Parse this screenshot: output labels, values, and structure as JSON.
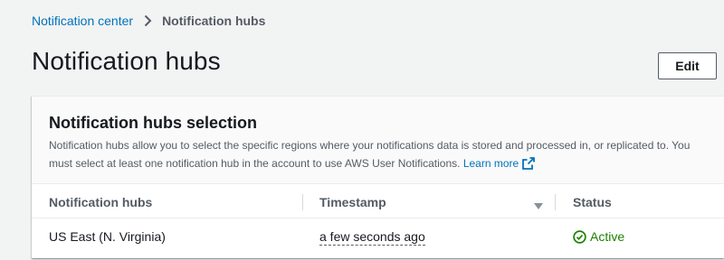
{
  "breadcrumb": {
    "parent": "Notification center",
    "current": "Notification hubs"
  },
  "page": {
    "title": "Notification hubs",
    "edit_label": "Edit"
  },
  "panel": {
    "title": "Notification hubs selection",
    "description": "Notification hubs allow you to select the specific regions where your notifications data is stored and processed in, or replicated to. You must select at least one notification hub in the account to use AWS User Notifications.",
    "learn_more": "Learn more"
  },
  "table": {
    "columns": [
      "Notification hubs",
      "Timestamp",
      "Status"
    ],
    "sorted_column": "Timestamp",
    "sort_direction": "descending",
    "rows": [
      {
        "hub": "US East (N. Virginia)",
        "timestamp": "a few seconds ago",
        "status": "Active"
      }
    ]
  },
  "colors": {
    "link": "#0073bb",
    "success": "#1d8102",
    "text": "#16191f",
    "secondary_text": "#545b64",
    "background": "#f2f3f3"
  },
  "icons": [
    "chevron-right-icon",
    "external-link-icon",
    "sort-down-icon",
    "check-circle-icon"
  ]
}
